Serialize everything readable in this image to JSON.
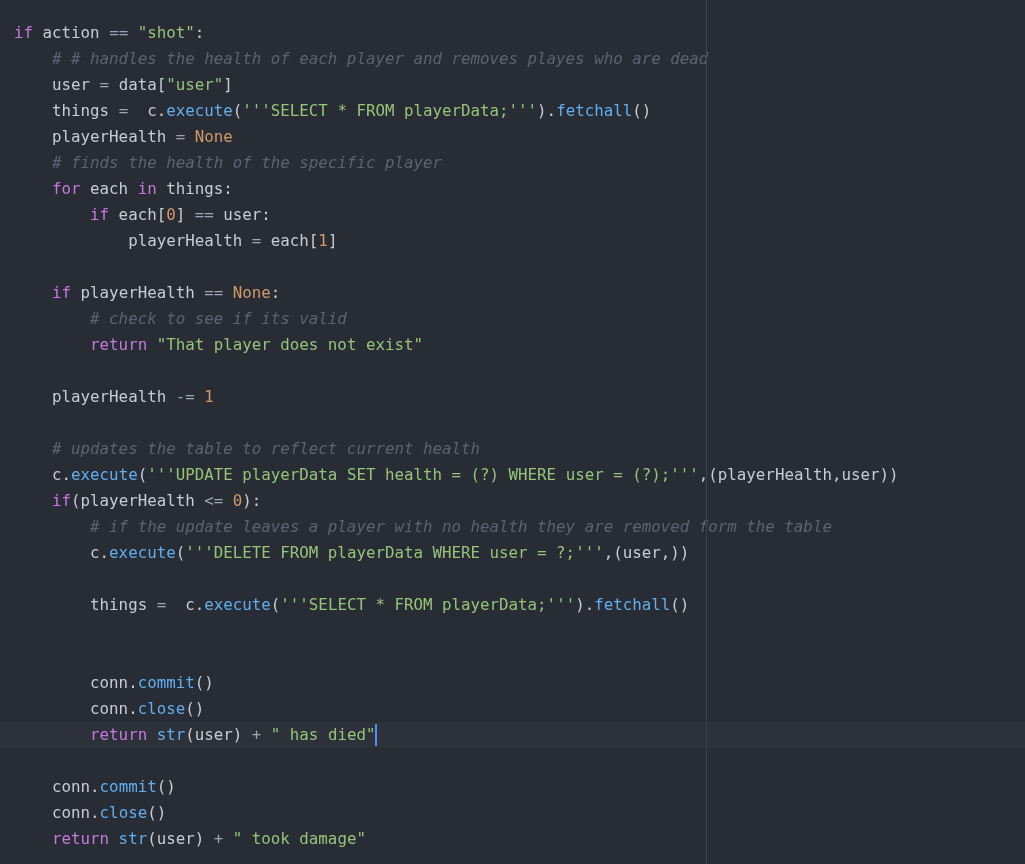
{
  "editor": {
    "lines": [
      {
        "current": false,
        "tokens": [
          {
            "kind": "k",
            "text": "if"
          },
          {
            "kind": "p",
            "text": " action "
          },
          {
            "kind": "o",
            "text": "== "
          },
          {
            "kind": "s",
            "text": "\"shot\""
          },
          {
            "kind": "p",
            "text": ":"
          }
        ]
      },
      {
        "current": false,
        "tokens": [
          {
            "kind": "c",
            "text": "    # # handles the health of each player and removes playes who are dead"
          }
        ]
      },
      {
        "current": false,
        "tokens": [
          {
            "kind": "p",
            "text": "    user "
          },
          {
            "kind": "o",
            "text": "="
          },
          {
            "kind": "p",
            "text": " data["
          },
          {
            "kind": "s",
            "text": "\"user\""
          },
          {
            "kind": "p",
            "text": "]"
          }
        ]
      },
      {
        "current": false,
        "tokens": [
          {
            "kind": "p",
            "text": "    things "
          },
          {
            "kind": "o",
            "text": "="
          },
          {
            "kind": "p",
            "text": "  c."
          },
          {
            "kind": "f",
            "text": "execute"
          },
          {
            "kind": "p",
            "text": "("
          },
          {
            "kind": "s",
            "text": "'''SELECT * FROM playerData;'''"
          },
          {
            "kind": "p",
            "text": ")."
          },
          {
            "kind": "f",
            "text": "fetchall"
          },
          {
            "kind": "p",
            "text": "()"
          }
        ]
      },
      {
        "current": false,
        "tokens": [
          {
            "kind": "p",
            "text": "    playerHealth "
          },
          {
            "kind": "o",
            "text": "= "
          },
          {
            "kind": "n",
            "text": "None"
          }
        ]
      },
      {
        "current": false,
        "tokens": [
          {
            "kind": "c",
            "text": "    # finds the health of the specific player"
          }
        ]
      },
      {
        "current": false,
        "tokens": [
          {
            "kind": "k",
            "text": "    for"
          },
          {
            "kind": "p",
            "text": " each "
          },
          {
            "kind": "k",
            "text": "in"
          },
          {
            "kind": "p",
            "text": " things:"
          }
        ]
      },
      {
        "current": false,
        "tokens": [
          {
            "kind": "k",
            "text": "        if"
          },
          {
            "kind": "p",
            "text": " each["
          },
          {
            "kind": "n",
            "text": "0"
          },
          {
            "kind": "p",
            "text": "] "
          },
          {
            "kind": "o",
            "text": "=="
          },
          {
            "kind": "p",
            "text": " user:"
          }
        ]
      },
      {
        "current": false,
        "tokens": [
          {
            "kind": "p",
            "text": "            playerHealth "
          },
          {
            "kind": "o",
            "text": "="
          },
          {
            "kind": "p",
            "text": " each["
          },
          {
            "kind": "n",
            "text": "1"
          },
          {
            "kind": "p",
            "text": "]"
          }
        ]
      },
      {
        "current": false
      },
      {
        "current": false,
        "tokens": [
          {
            "kind": "k",
            "text": "    if"
          },
          {
            "kind": "p",
            "text": " playerHealth "
          },
          {
            "kind": "o",
            "text": "== "
          },
          {
            "kind": "n",
            "text": "None"
          },
          {
            "kind": "p",
            "text": ":"
          }
        ]
      },
      {
        "current": false,
        "tokens": [
          {
            "kind": "c",
            "text": "        # check to see if its valid"
          }
        ]
      },
      {
        "current": false,
        "tokens": [
          {
            "kind": "k",
            "text": "        return"
          },
          {
            "kind": "s",
            "text": " \"That player does not exist\""
          }
        ]
      },
      {
        "current": false
      },
      {
        "current": false,
        "tokens": [
          {
            "kind": "p",
            "text": "    playerHealth "
          },
          {
            "kind": "o",
            "text": "-= "
          },
          {
            "kind": "n",
            "text": "1"
          }
        ]
      },
      {
        "current": false
      },
      {
        "current": false,
        "tokens": [
          {
            "kind": "c",
            "text": "    # updates the table to reflect current health"
          }
        ]
      },
      {
        "current": false,
        "tokens": [
          {
            "kind": "p",
            "text": "    c."
          },
          {
            "kind": "f",
            "text": "execute"
          },
          {
            "kind": "p",
            "text": "("
          },
          {
            "kind": "s",
            "text": "'''UPDATE playerData SET health = (?) WHERE user = (?);'''"
          },
          {
            "kind": "p",
            "text": ",(playerHealth,user))"
          }
        ]
      },
      {
        "current": false,
        "tokens": [
          {
            "kind": "k",
            "text": "    if"
          },
          {
            "kind": "p",
            "text": "(playerHealth "
          },
          {
            "kind": "o",
            "text": "<= "
          },
          {
            "kind": "n",
            "text": "0"
          },
          {
            "kind": "p",
            "text": "):"
          }
        ]
      },
      {
        "current": false,
        "tokens": [
          {
            "kind": "c",
            "text": "        # if the update leaves a player with no health they are removed form the table"
          }
        ]
      },
      {
        "current": false,
        "tokens": [
          {
            "kind": "p",
            "text": "        c."
          },
          {
            "kind": "f",
            "text": "execute"
          },
          {
            "kind": "p",
            "text": "("
          },
          {
            "kind": "s",
            "text": "'''DELETE FROM playerData WHERE user = ?;'''"
          },
          {
            "kind": "p",
            "text": ",(user,))"
          }
        ]
      },
      {
        "current": false
      },
      {
        "current": false,
        "tokens": [
          {
            "kind": "p",
            "text": "        things "
          },
          {
            "kind": "o",
            "text": "="
          },
          {
            "kind": "p",
            "text": "  c."
          },
          {
            "kind": "f",
            "text": "execute"
          },
          {
            "kind": "p",
            "text": "("
          },
          {
            "kind": "s",
            "text": "'''SELECT * FROM playerData;'''"
          },
          {
            "kind": "p",
            "text": ")."
          },
          {
            "kind": "f",
            "text": "fetchall"
          },
          {
            "kind": "p",
            "text": "()"
          }
        ]
      },
      {
        "current": false
      },
      {
        "current": false
      },
      {
        "current": false,
        "tokens": [
          {
            "kind": "p",
            "text": "        conn."
          },
          {
            "kind": "f",
            "text": "commit"
          },
          {
            "kind": "p",
            "text": "()"
          }
        ]
      },
      {
        "current": false,
        "tokens": [
          {
            "kind": "p",
            "text": "        conn."
          },
          {
            "kind": "f",
            "text": "close"
          },
          {
            "kind": "p",
            "text": "()"
          }
        ]
      },
      {
        "current": true,
        "tokens": [
          {
            "kind": "k",
            "text": "        return"
          },
          {
            "kind": "f",
            "text": " str"
          },
          {
            "kind": "p",
            "text": "(user) "
          },
          {
            "kind": "o",
            "text": "+ "
          },
          {
            "kind": "s",
            "text": "\" has died\""
          }
        ]
      },
      {
        "current": false
      },
      {
        "current": false,
        "tokens": [
          {
            "kind": "p",
            "text": "    conn."
          },
          {
            "kind": "f",
            "text": "commit"
          },
          {
            "kind": "p",
            "text": "()"
          }
        ]
      },
      {
        "current": false,
        "tokens": [
          {
            "kind": "p",
            "text": "    conn."
          },
          {
            "kind": "f",
            "text": "close"
          },
          {
            "kind": "p",
            "text": "()"
          }
        ]
      },
      {
        "current": false,
        "tokens": [
          {
            "kind": "k",
            "text": "    return"
          },
          {
            "kind": "f",
            "text": " str"
          },
          {
            "kind": "p",
            "text": "(user) "
          },
          {
            "kind": "o",
            "text": "+ "
          },
          {
            "kind": "s",
            "text": "\" took damage\""
          }
        ]
      }
    ]
  }
}
